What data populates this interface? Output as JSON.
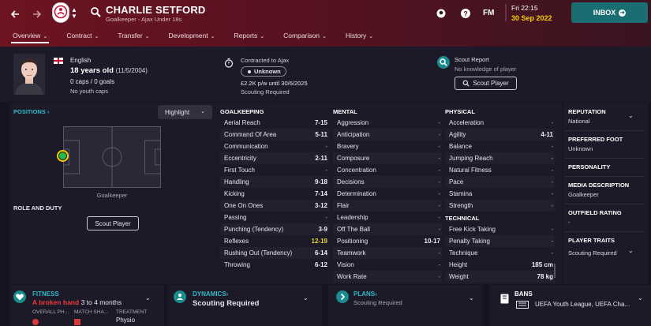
{
  "header": {
    "player_name": "CHARLIE SETFORD",
    "player_sub": "Goalkeeper - Ajax Under 18s",
    "fm_label": "FM",
    "date_line1": "Fri 22:15",
    "date_line2": "30 Sep 2022",
    "inbox_label": "INBOX",
    "tabs": [
      "Overview",
      "Contract",
      "Transfer",
      "Development",
      "Reports",
      "Comparison",
      "History"
    ]
  },
  "info": {
    "nationality": "English",
    "age": "18 years old",
    "dob": "(11/5/2004)",
    "caps": "0 caps / 0 goals",
    "youth_caps": "No youth caps",
    "contract_title": "Contracted to Ajax",
    "contract_status": "Unknown",
    "wage": "£2.2K p/w until 30/6/2025",
    "scouting_required": "Scouting Required",
    "scout_report_title": "Scout Report",
    "scout_knowledge": "No knowledge of player",
    "scout_button": "Scout Player"
  },
  "positions": {
    "title": "POSITIONS",
    "highlight_label": "Highlight",
    "position_label": "Goalkeeper",
    "role_title": "ROLE AND DUTY",
    "role_button": "Scout Player"
  },
  "attributes": {
    "goalkeeping": {
      "title": "GOALKEEPING",
      "rows": [
        {
          "name": "Aerial Reach",
          "value": "7-15"
        },
        {
          "name": "Command Of Area",
          "value": "5-11"
        },
        {
          "name": "Communication",
          "value": "-"
        },
        {
          "name": "Eccentricity",
          "value": "2-11"
        },
        {
          "name": "First Touch",
          "value": "-"
        },
        {
          "name": "Handling",
          "value": "9-18"
        },
        {
          "name": "Kicking",
          "value": "7-14"
        },
        {
          "name": "One On Ones",
          "value": "3-12"
        },
        {
          "name": "Passing",
          "value": "-"
        },
        {
          "name": "Punching (Tendency)",
          "value": "3-9"
        },
        {
          "name": "Reflexes",
          "value": "12-19"
        },
        {
          "name": "Rushing Out (Tendency)",
          "value": "6-14"
        },
        {
          "name": "Throwing",
          "value": "6-12"
        }
      ]
    },
    "mental": {
      "title": "MENTAL",
      "rows": [
        {
          "name": "Aggression",
          "value": "-"
        },
        {
          "name": "Anticipation",
          "value": "-"
        },
        {
          "name": "Bravery",
          "value": "-"
        },
        {
          "name": "Composure",
          "value": "-"
        },
        {
          "name": "Concentration",
          "value": "-"
        },
        {
          "name": "Decisions",
          "value": "-"
        },
        {
          "name": "Determination",
          "value": "-"
        },
        {
          "name": "Flair",
          "value": "-"
        },
        {
          "name": "Leadership",
          "value": "-"
        },
        {
          "name": "Off The Ball",
          "value": "-"
        },
        {
          "name": "Positioning",
          "value": "10-17"
        },
        {
          "name": "Teamwork",
          "value": "-"
        },
        {
          "name": "Vision",
          "value": "-"
        },
        {
          "name": "Work Rate",
          "value": "-"
        }
      ]
    },
    "physical": {
      "title": "PHYSICAL",
      "rows": [
        {
          "name": "Acceleration",
          "value": "-"
        },
        {
          "name": "Agility",
          "value": "4-11"
        },
        {
          "name": "Balance",
          "value": "-"
        },
        {
          "name": "Jumping Reach",
          "value": "-"
        },
        {
          "name": "Natural Fitness",
          "value": "-"
        },
        {
          "name": "Pace",
          "value": "-"
        },
        {
          "name": "Stamina",
          "value": "-"
        },
        {
          "name": "Strength",
          "value": "-"
        }
      ]
    },
    "technical": {
      "title": "TECHNICAL",
      "rows": [
        {
          "name": "Free Kick Taking",
          "value": "-"
        },
        {
          "name": "Penalty Taking",
          "value": "-"
        },
        {
          "name": "Technique",
          "value": "-"
        }
      ]
    },
    "body": [
      {
        "name": "Height",
        "value": "185 cm"
      },
      {
        "name": "Weight",
        "value": "78 kg"
      }
    ]
  },
  "side": {
    "reputation_label": "REPUTATION",
    "reputation_value": "National",
    "foot_label": "PREFERRED FOOT",
    "foot_value": "Unknown",
    "personality_label": "PERSONALITY",
    "media_label": "MEDIA DESCRIPTION",
    "media_value": "Goalkeeper",
    "outfield_label": "OUTFIELD RATING",
    "outfield_value": "-",
    "traits_label": "PLAYER TRAITS",
    "traits_value": "Scouting Required"
  },
  "bottom": {
    "fitness_title": "FITNESS",
    "injury_name": "A broken hand",
    "injury_duration": "3 to 4 months",
    "overall_label": "OVERALL PH...",
    "match_label": "MATCH SHA...",
    "treatment_label": "TREATMENT",
    "treatment_value": "Physio",
    "dynamics_title": "DYNAMICS",
    "dynamics_value": "Scouting Required",
    "plans_title": "PLANS",
    "plans_value": "Scouting Required",
    "bans_title": "BANS",
    "bans_value": "UEFA Youth League, UEFA Cha..."
  }
}
